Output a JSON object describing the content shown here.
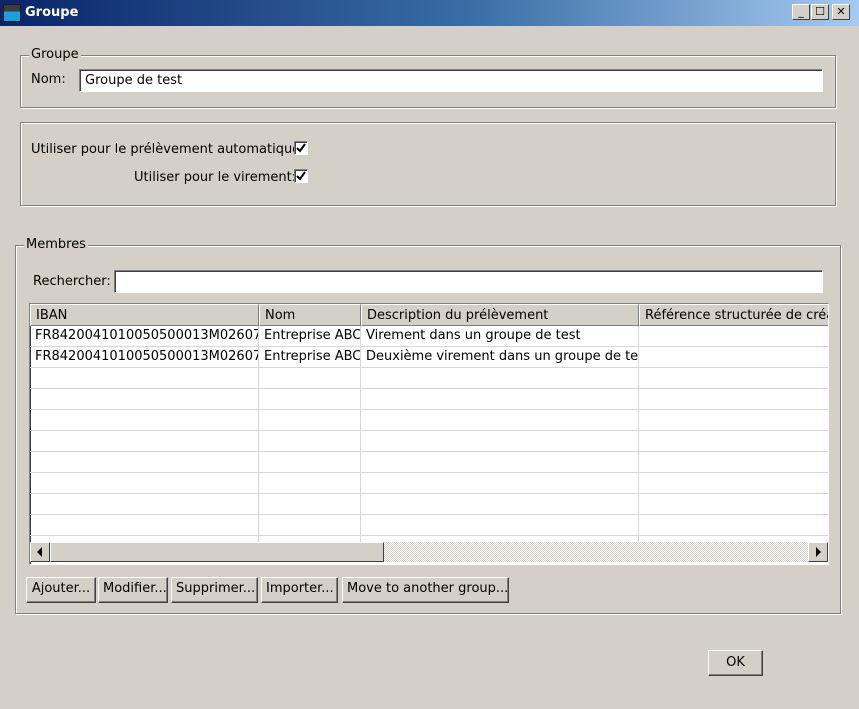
{
  "window": {
    "title": "Groupe",
    "buttons": {
      "minimize": "_",
      "maximize": "☐",
      "close": "✕"
    }
  },
  "group": {
    "legend": "Groupe",
    "name_label": "Nom:",
    "name_value": "Groupe de test"
  },
  "options": {
    "direct_debit_label": "Utiliser pour le prélèvement automatique:",
    "direct_debit_checked": true,
    "transfer_label": "Utiliser pour le virement:",
    "transfer_checked": true
  },
  "members": {
    "legend": "Membres",
    "search_label": "Rechercher:",
    "search_value": "",
    "columns": [
      "IBAN",
      "Nom",
      "Description du prélèvement",
      "Référence structurée de créan"
    ],
    "rows": [
      [
        "FR8420041010050500013M02607",
        "Entreprise ABC",
        "Virement dans un groupe de test",
        ""
      ],
      [
        "FR8420041010050500013M02607",
        "Entreprise ABC",
        "Deuxième virement dans un groupe de test",
        ""
      ]
    ],
    "buttons": {
      "add": "Ajouter...",
      "edit": "Modifier...",
      "delete": "Supprimer...",
      "import": "Importer...",
      "move": "Move to another group..."
    }
  },
  "footer": {
    "ok": "OK"
  }
}
